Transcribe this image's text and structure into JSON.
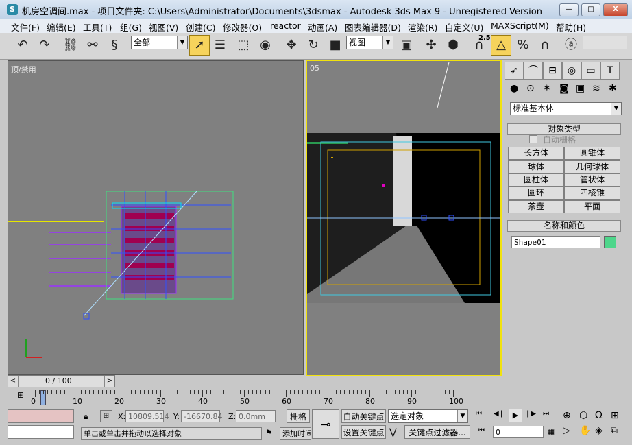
{
  "window": {
    "title": "机房空调间.max    - 项目文件夹: C:\\Users\\Administrator\\Documents\\3dsmax    - Autodesk 3ds Max 9  - Unregistered Version",
    "minimize": "—",
    "maximize": "□",
    "close": "X"
  },
  "menu": [
    "文件(F)",
    "编辑(E)",
    "工具(T)",
    "组(G)",
    "视图(V)",
    "创建(C)",
    "修改器(O)",
    "reactor",
    "动画(A)",
    "图表编辑器(D)",
    "渲染(R)",
    "自定义(U)",
    "MAXScript(M)",
    "帮助(H)"
  ],
  "toolbar": {
    "selection_filter": "全部",
    "ref_coord": "视图",
    "snap_value": "2.5",
    "named_selection": ""
  },
  "viewports": {
    "left_label": "顶/禁用",
    "right_label": "05"
  },
  "command_panel": {
    "category_dropdown": "标准基本体",
    "object_type_title": "对象类型",
    "autogrid_label": "自动栅格",
    "buttons": [
      "长方体",
      "圆锥体",
      "球体",
      "几何球体",
      "圆柱体",
      "管状体",
      "圆环",
      "四棱锥",
      "茶壶",
      "平面"
    ],
    "name_color_title": "名称和颜色",
    "object_name": "Shape01",
    "object_color": "#4ed68b"
  },
  "time": {
    "counter": "0 / 100",
    "ticks": [
      "0",
      "10",
      "20",
      "30",
      "40",
      "50",
      "60",
      "70",
      "80",
      "90",
      "100"
    ]
  },
  "status": {
    "x_label": "X:",
    "x_value": "10809.514",
    "y_label": "Y:",
    "y_value": "-16670.84",
    "z_label": "Z:",
    "z_value": "0.0mm",
    "grid_btn": "栅格",
    "prompt": "单击或单击并拖动以选择对象",
    "add_time_tag": "添加时间标记",
    "auto_key": "自动关键点",
    "set_key": "设置关键点",
    "selected_objects": "选定对象",
    "key_filters": "关键点过滤器...",
    "frame": "0"
  }
}
